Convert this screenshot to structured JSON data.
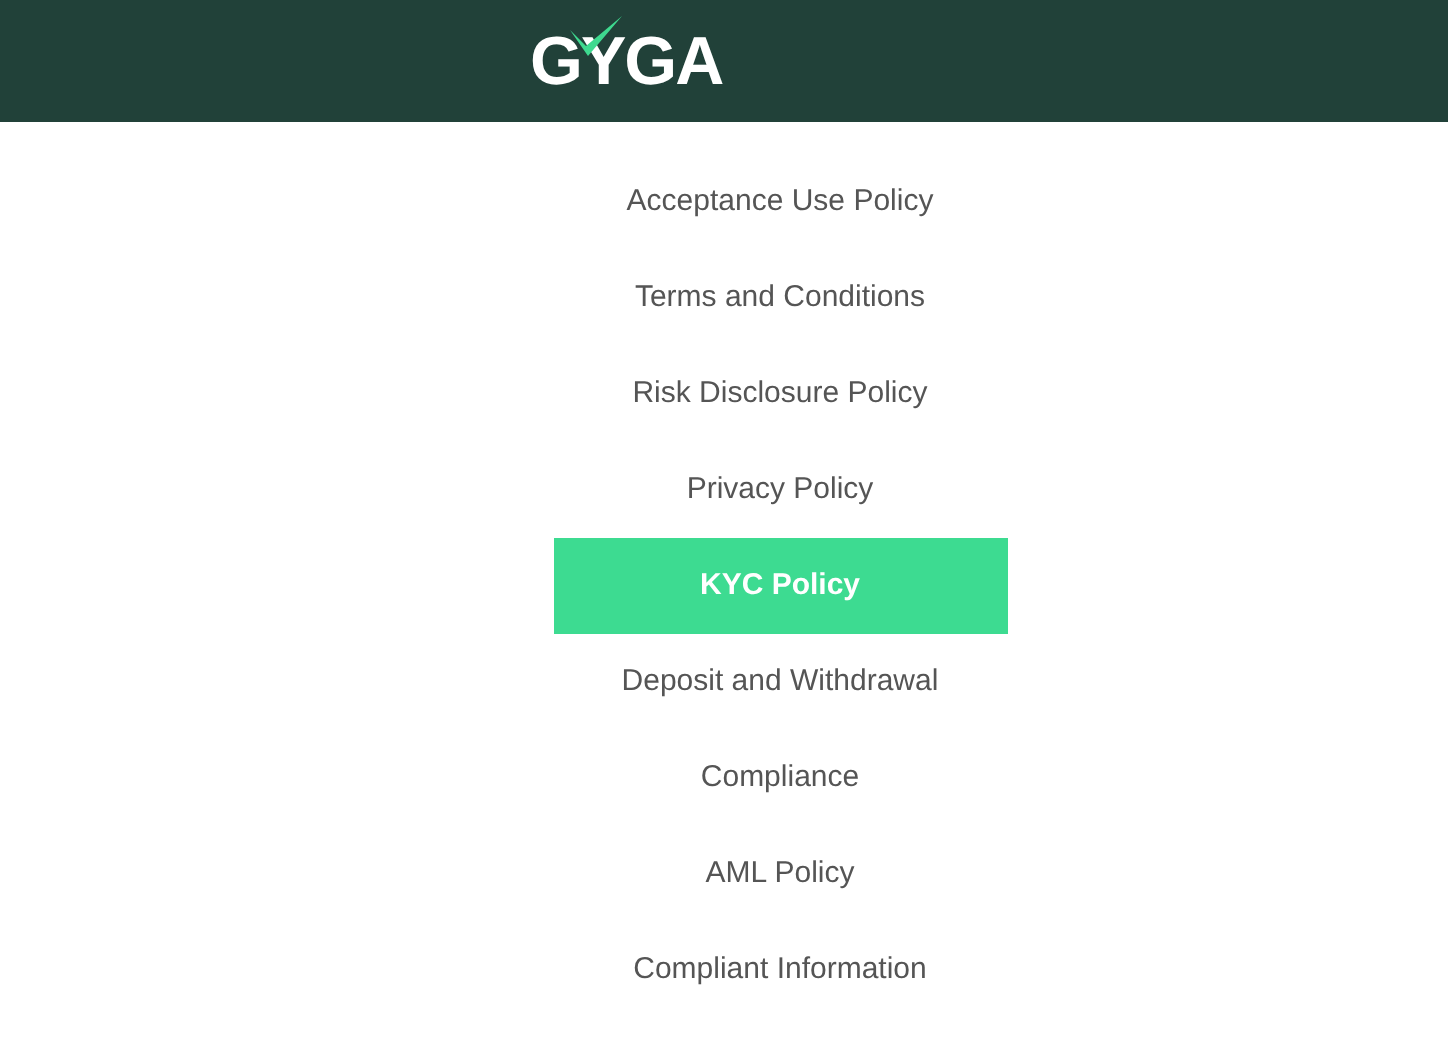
{
  "header": {
    "logo": "GYGA"
  },
  "menu": [
    {
      "label": "Acceptance Use Policy",
      "selected": false
    },
    {
      "label": "Terms and Conditions",
      "selected": false
    },
    {
      "label": "Risk Disclosure Policy",
      "selected": false
    },
    {
      "label": "Privacy Policy",
      "selected": false
    },
    {
      "label": "KYC Policy",
      "selected": true
    },
    {
      "label": "Deposit and Withdrawal",
      "selected": false
    },
    {
      "label": "Compliance",
      "selected": false
    },
    {
      "label": "AML Policy",
      "selected": false
    },
    {
      "label": "Compliant Information",
      "selected": false
    }
  ]
}
